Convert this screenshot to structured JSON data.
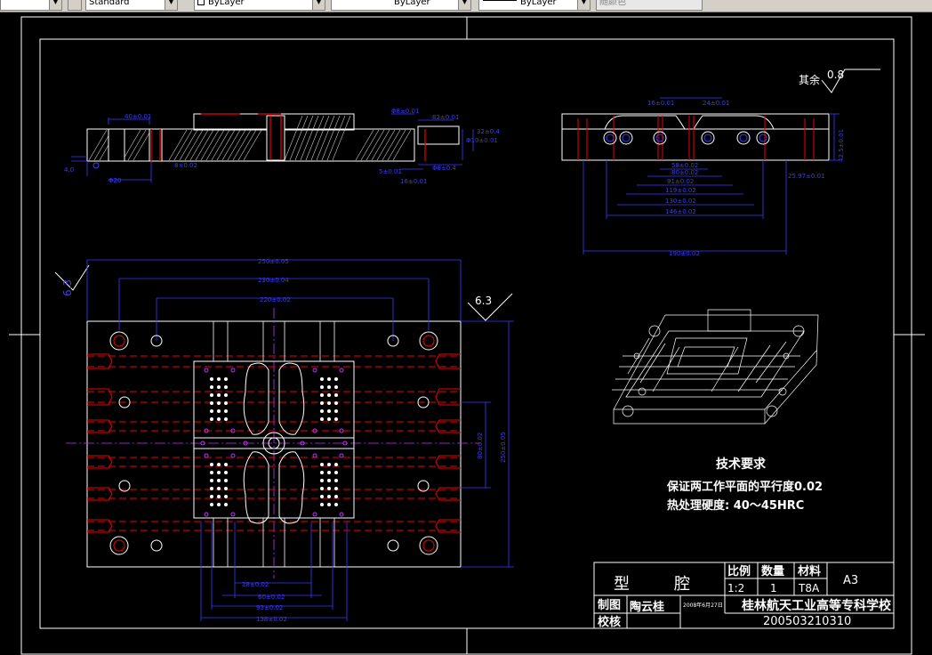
{
  "toolbar": {
    "text_style": "Standard",
    "layer": "ByLayer",
    "linetype": "ByLayer",
    "lineweight": "ByLayer",
    "plot_style": "随颜色"
  },
  "drawing": {
    "roughness_other": "其余",
    "roughness_other_value": "0.8",
    "roughness_top_left": "6.3",
    "roughness_mid": "6.3",
    "tech_title": "技术要求",
    "tech_line1": "保证两工作平面的平行度0.02",
    "tech_line2": "热处理硬度: 40～45HRC",
    "title_block": {
      "part_name_1": "型",
      "part_name_2": "腔",
      "scale_label": "比例",
      "scale_value": "1:2",
      "qty_label": "数量",
      "qty_value": "1",
      "material_label": "材料",
      "material_value": "T8A",
      "sheet_size": "A3",
      "drawn_label": "制图",
      "drawn_by": "陶云桂",
      "date": "2008年6月27日",
      "check_label": "校核",
      "school": "桂林航天工业高等专科学校",
      "student_no": "200503210310"
    },
    "dims": {
      "top_a": "40±0.01",
      "top_b": "8×0.02",
      "top_c": "82±0.01",
      "top_d": "4.0",
      "right_top1": "16±0.01",
      "right_top2": "24±0.01",
      "right_w1": "58±0.02",
      "right_w2": "80±0.02",
      "right_w3": "91±0.02",
      "right_w4": "119±0.02",
      "right_w5": "130±0.02",
      "right_w6": "146±0.02",
      "right_w7": "190±0.02",
      "right_h1": "42.5±0.01",
      "right_h2": "25.97±0.01",
      "plan_w1": "250±0.05",
      "plan_w2": "230±0.04",
      "plan_w3": "220±0.02",
      "plan_h1": "250±0.05",
      "plan_h2": "80±0.02",
      "plan_b1": "28±0.02",
      "plan_b2": "60±0.02",
      "plan_b3": "93±0.02",
      "plan_b4": "138±0.02"
    }
  }
}
